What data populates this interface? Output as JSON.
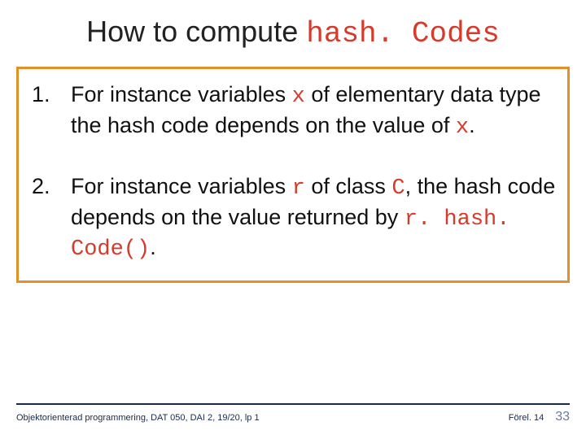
{
  "title": {
    "prefix": "How to compute ",
    "code": "hash. Codes"
  },
  "points": [
    {
      "t1": "For instance variables ",
      "c1": "x",
      "t2": " of elementary data type the hash code depends on the value of ",
      "c2": "x",
      "t3": "."
    },
    {
      "t1": "For instance variables ",
      "c1": "r",
      "t2": " of class ",
      "c2": "C",
      "t3": ", the hash code depends on the value returned by ",
      "c3": "r. hash. Code()",
      "t4": "."
    }
  ],
  "footer": {
    "left": "Objektorienterad programmering, DAT 050, DAI 2, 19/20, lp 1",
    "lecture": "Förel. 14",
    "page": "33"
  }
}
